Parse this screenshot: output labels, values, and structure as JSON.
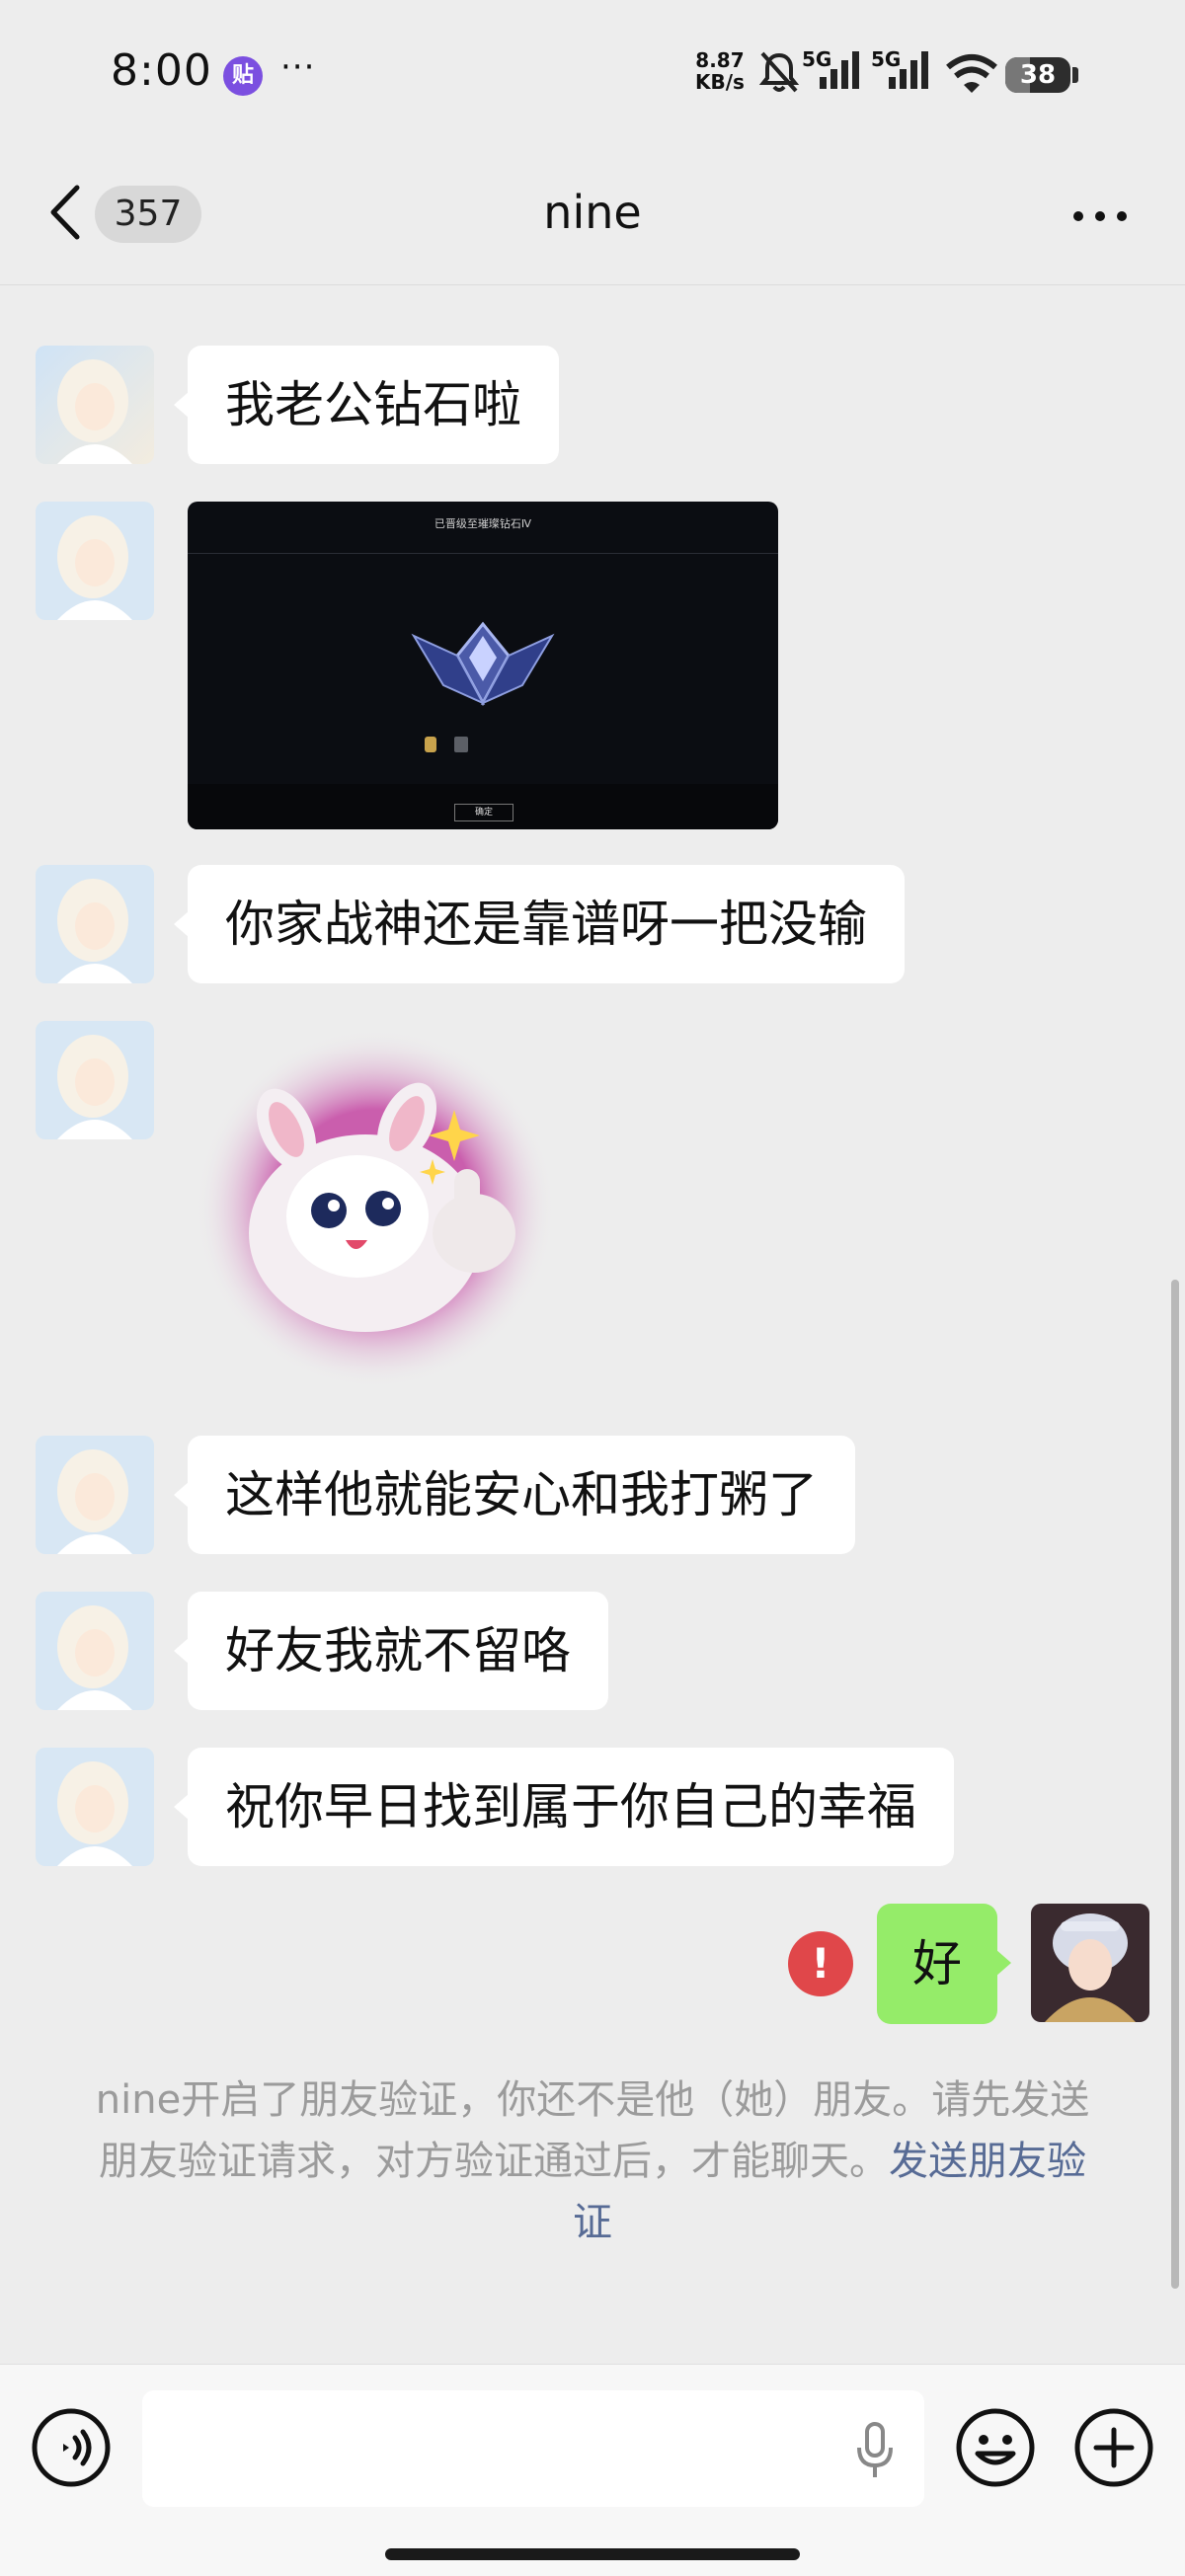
{
  "status_bar": {
    "time": "8:00",
    "tie_badge": "贴",
    "more_dots": "···",
    "net_speed_value": "8.87",
    "net_speed_unit": "KB/s",
    "signal1_label": "5G",
    "signal2_label": "5G",
    "battery_level": "38",
    "icons": [
      "bell-muted-icon",
      "signal-5g-icon",
      "signal-5g-icon",
      "wifi-icon",
      "battery-icon"
    ]
  },
  "header": {
    "unread_count": "357",
    "title": "nine",
    "back_icon": "chevron-left-icon",
    "more_icon": "more-dots-icon"
  },
  "messages": [
    {
      "from": "them",
      "type": "text",
      "text": "我老公钻石啦"
    },
    {
      "from": "them",
      "type": "image",
      "image_text": "已晋级至璀璨钻石Ⅳ",
      "image_button": "确定"
    },
    {
      "from": "them",
      "type": "text",
      "text": "你家战神还是靠谱呀一把没输"
    },
    {
      "from": "them",
      "type": "sticker",
      "sticker": "thumbs-up-sheep-sticker"
    },
    {
      "from": "them",
      "type": "text",
      "text": "这样他就能安心和我打粥了"
    },
    {
      "from": "them",
      "type": "text",
      "text": "好友我就不留咯"
    },
    {
      "from": "them",
      "type": "text",
      "text": "祝你早日找到属于你自己的幸福"
    },
    {
      "from": "me",
      "type": "text",
      "text": "好",
      "status": "failed",
      "status_glyph": "!"
    }
  ],
  "notice": {
    "text": "nine开启了朋友验证，你还不是他（她）朋友。请先发送朋友验证请求，对方验证通过后，才能聊天。",
    "link": "发送朋友验证"
  },
  "input_bar": {
    "value": "",
    "voice_icon": "voice-mode-icon",
    "mic_icon": "microphone-icon",
    "emoji_icon": "emoji-icon",
    "plus_icon": "plus-icon"
  },
  "colors": {
    "background": "#ededed",
    "my_bubble": "#95ec69",
    "their_bubble": "#ffffff",
    "link": "#576b95",
    "error": "#e0474a"
  }
}
